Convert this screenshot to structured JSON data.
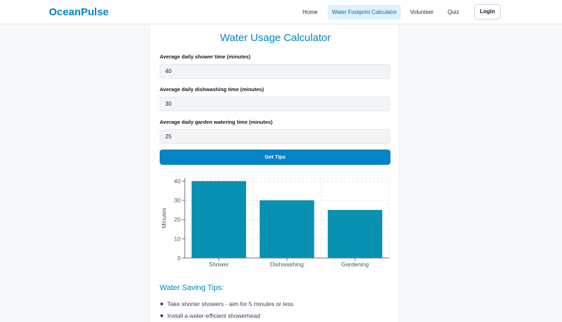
{
  "header": {
    "brand": "OceanPulse",
    "nav": [
      {
        "label": "Home",
        "active": false
      },
      {
        "label": "Water Footprint Calculator",
        "active": true
      },
      {
        "label": "Volunteer",
        "active": false
      },
      {
        "label": "Quiz",
        "active": false
      }
    ],
    "login_label": "Login"
  },
  "calculator": {
    "title": "Water Usage Calculator",
    "fields": [
      {
        "label": "Average daily shower time (minutes)",
        "value": "40"
      },
      {
        "label": "Average daily dishwashing time (minutes)",
        "value": "30"
      },
      {
        "label": "Average daily garden watering time (minutes)",
        "value": "25"
      }
    ],
    "submit_label": "Get Tips"
  },
  "chart_data": {
    "type": "bar",
    "categories": [
      "Shower",
      "Dishwashing",
      "Gardening"
    ],
    "values": [
      40,
      30,
      25
    ],
    "ylabel": "Minutes",
    "xlabel": "",
    "ylim": [
      0,
      40
    ],
    "yticks": [
      "0",
      "10",
      "20",
      "30",
      "40"
    ],
    "grid": true,
    "bar_color": "#0891b2"
  },
  "tips": {
    "heading": "Water Saving Tips:",
    "items": [
      "Take shorter showers - aim for 5 minutes or less",
      "Install a water-efficient showerhead"
    ]
  },
  "colors": {
    "accent": "#0284c7",
    "active_nav_bg": "#e0f2fe"
  }
}
